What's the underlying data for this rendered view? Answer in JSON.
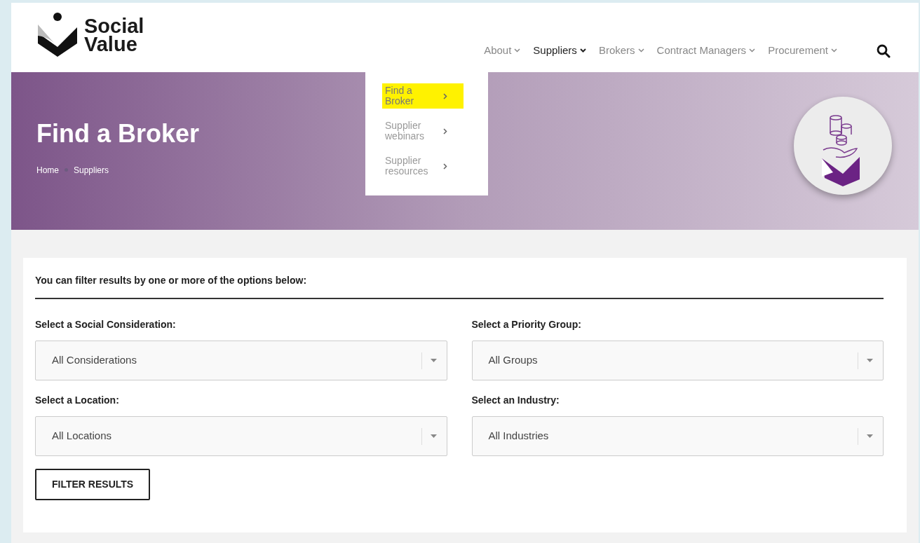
{
  "logo": {
    "line1": "Social",
    "line2": "Value"
  },
  "nav": [
    {
      "label": "About",
      "selected": false
    },
    {
      "label": "Suppliers",
      "selected": true
    },
    {
      "label": "Brokers",
      "selected": false
    },
    {
      "label": "Contract Managers",
      "selected": false
    },
    {
      "label": "Procurement",
      "selected": false
    }
  ],
  "dropdown": [
    {
      "label": "Find a Broker",
      "highlighted": true
    },
    {
      "label": "Supplier webinars",
      "highlighted": false
    },
    {
      "label": "Supplier resources",
      "highlighted": false
    }
  ],
  "hero": {
    "title": "Find a Broker",
    "breadcrumbs": [
      "Home",
      "Suppliers"
    ]
  },
  "filter": {
    "intro": "You can filter results by one or more of the options below:",
    "fields": [
      {
        "label": "Select a Social Consideration:",
        "value": "All Considerations"
      },
      {
        "label": "Select a Priority Group:",
        "value": "All Groups"
      },
      {
        "label": "Select a Location:",
        "value": "All Locations"
      },
      {
        "label": "Select an Industry:",
        "value": "All Industries"
      }
    ],
    "button": "FILTER RESULTS"
  }
}
